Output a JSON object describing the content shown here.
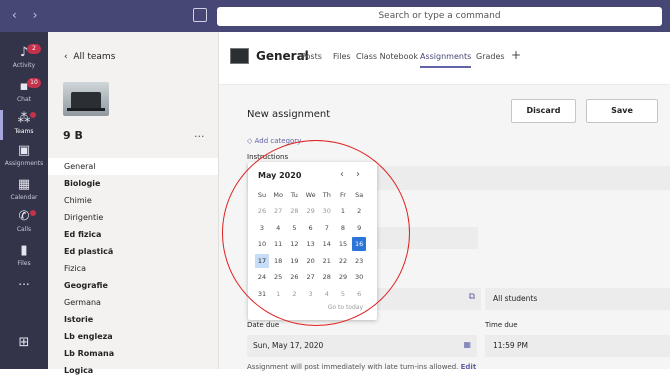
{
  "search": {
    "placeholder": "Search or type a command"
  },
  "rail": {
    "items": [
      {
        "label": "Activity",
        "icon": "bell-icon",
        "badge": "2"
      },
      {
        "label": "Chat",
        "icon": "chat-icon",
        "badge": "10"
      },
      {
        "label": "Teams",
        "icon": "teams-icon",
        "badge": ""
      },
      {
        "label": "Assignments",
        "icon": "assignments-icon",
        "badge": ""
      },
      {
        "label": "Calendar",
        "icon": "calendar-icon",
        "badge": ""
      },
      {
        "label": "Calls",
        "icon": "phone-icon",
        "badge": ""
      },
      {
        "label": "Files",
        "icon": "file-icon",
        "badge": ""
      }
    ],
    "more": "...",
    "bottom_icon": "apps-icon"
  },
  "teams_panel": {
    "back_label": "All teams",
    "team_name": "9 B",
    "more": "...",
    "channels": [
      "General",
      "Biologie",
      "Chimie",
      "Dirigentie",
      "Ed fizica",
      "Ed plastică",
      "Fizica",
      "Geografie",
      "Germana",
      "Istorie",
      "Lb engleza",
      "Lb Romana",
      "Logica"
    ]
  },
  "header": {
    "title": "General",
    "tabs": [
      "Posts",
      "Files",
      "Class Notebook",
      "Assignments",
      "Grades"
    ],
    "active_tab": "Assignments",
    "add_tab": "+"
  },
  "form": {
    "title": "New assignment",
    "discard_label": "Discard",
    "save_label": "Save",
    "add_category": "Add category",
    "instructions_label": "Instructions",
    "assign_to_value": "All students",
    "date_due_label": "Date due",
    "date_due_value": "Sun, May 17, 2020",
    "time_due_label": "Time due",
    "time_due_value": "11:59 PM",
    "late_note": "Assignment will post immediately with late turn-ins allowed.",
    "edit_link": "Edit"
  },
  "calendar": {
    "month": "May 2020",
    "weekdays": [
      "Su",
      "Mo",
      "Tu",
      "We",
      "Th",
      "Fr",
      "Sa"
    ],
    "weeks": [
      [
        "26",
        "27",
        "28",
        "29",
        "30",
        "1",
        "2"
      ],
      [
        "3",
        "4",
        "5",
        "6",
        "7",
        "8",
        "9"
      ],
      [
        "10",
        "11",
        "12",
        "13",
        "14",
        "15",
        "16"
      ],
      [
        "17",
        "18",
        "19",
        "20",
        "21",
        "22",
        "23"
      ],
      [
        "24",
        "25",
        "26",
        "27",
        "28",
        "29",
        "30"
      ],
      [
        "31",
        "1",
        "2",
        "3",
        "4",
        "5",
        "6"
      ]
    ],
    "today": "16",
    "selected": "17",
    "go_to_today": "Go to today"
  },
  "colors": {
    "topbar": "#464775",
    "rail": "#33344a",
    "accent": "#6264a7",
    "today_blue": "#2b74d8",
    "annotation_red": "#e02020"
  }
}
